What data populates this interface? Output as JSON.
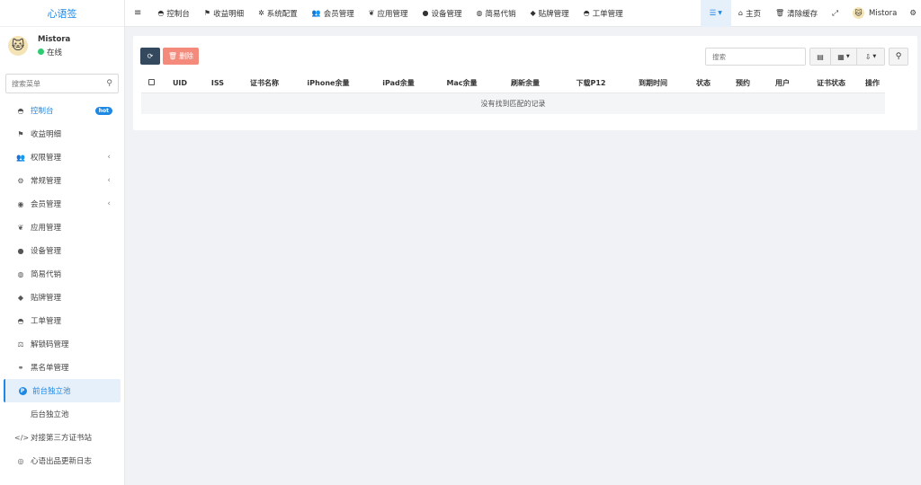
{
  "app": {
    "logo_text": "心语签"
  },
  "user": {
    "name": "Mistora",
    "status": "在线"
  },
  "sidebar": {
    "search_placeholder": "搜索菜单",
    "items": [
      {
        "label": "控制台",
        "icon": "dashboard-icon",
        "badge": "hot"
      },
      {
        "label": "收益明细",
        "icon": "flag-icon"
      },
      {
        "label": "权限管理",
        "icon": "group-icon",
        "chevron": "‹"
      },
      {
        "label": "常规管理",
        "icon": "cogs-icon",
        "chevron": "‹"
      },
      {
        "label": "会员管理",
        "icon": "user-circle-icon",
        "chevron": "‹"
      },
      {
        "label": "应用管理",
        "icon": "leaf-icon"
      },
      {
        "label": "设备管理",
        "icon": "device-icon"
      },
      {
        "label": "简易代销",
        "icon": "circle-icon"
      },
      {
        "label": "贴牌管理",
        "icon": "tags-icon"
      },
      {
        "label": "工单管理",
        "icon": "ticket-icon"
      },
      {
        "label": "解锁码管理",
        "icon": "balance-scale-icon"
      },
      {
        "label": "黑名单管理",
        "icon": "bicycle-icon"
      },
      {
        "label": "前台独立池",
        "icon": "p-circle-icon"
      },
      {
        "label": "后台独立池",
        "icon": "apple-icon"
      },
      {
        "label": "对接第三方证书站",
        "icon": "code-icon"
      },
      {
        "label": "心语出品更新日志",
        "icon": "eye-icon"
      }
    ]
  },
  "topnav": {
    "items": [
      {
        "label": "控制台",
        "icon": "dashboard-icon"
      },
      {
        "label": "收益明细",
        "icon": "flag-icon"
      },
      {
        "label": "系统配置",
        "icon": "cog-icon"
      },
      {
        "label": "会员管理",
        "icon": "users-icon"
      },
      {
        "label": "应用管理",
        "icon": "leaf-icon"
      },
      {
        "label": "设备管理",
        "icon": "device-icon"
      },
      {
        "label": "简易代销",
        "icon": "circle-icon"
      },
      {
        "label": "贴牌管理",
        "icon": "tags-icon"
      },
      {
        "label": "工单管理",
        "icon": "ticket-icon"
      }
    ],
    "home_label": "主页",
    "clear_cache_label": "清除缓存",
    "username": "Mistora"
  },
  "toolbar": {
    "delete_label": "删除",
    "search_placeholder": "搜索"
  },
  "table": {
    "columns": [
      "UID",
      "ISS",
      "证书名称",
      "iPhone余量",
      "iPad余量",
      "Mac余量",
      "刷新余量",
      "下载P12",
      "到期时间",
      "状态",
      "预约",
      "用户",
      "证书状态",
      "操作"
    ],
    "empty_text": "没有找到匹配的记录"
  },
  "colors": {
    "accent": "#1e88e5",
    "online": "#2ecc71",
    "delete": "#f38a7b",
    "refresh": "#34495e"
  }
}
